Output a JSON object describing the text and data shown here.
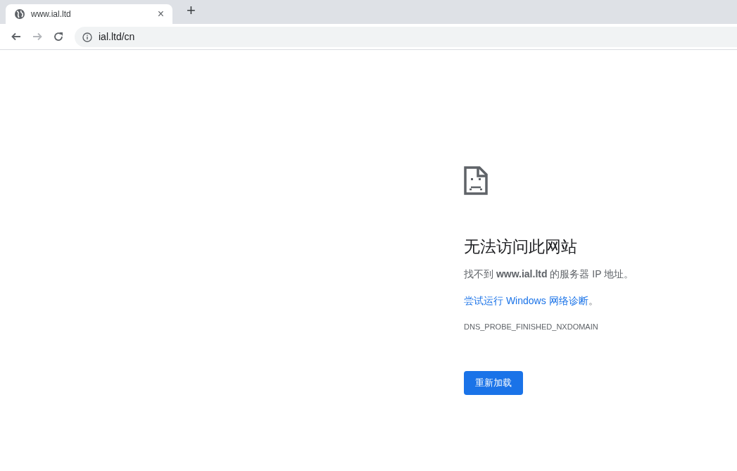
{
  "tabs": [
    {
      "title": "www.ial.ltd",
      "selected": true,
      "close": "×"
    }
  ],
  "new_tab": "+",
  "toolbar": {
    "back": {
      "disabled": false
    },
    "forward": {
      "disabled": true
    },
    "reload": {
      "disabled": false
    }
  },
  "address_bar": {
    "value": "ial.ltd/cn"
  },
  "error": {
    "title": "无法访问此网站",
    "message": "找不到 **www.ial.ltd** 的服务器 IP 地址。",
    "suggestion_link": "尝试运行 Windows 网络诊断",
    "suggestion_after": "。",
    "code": "DNS_PROBE_FINISHED_NXDOMAIN",
    "button": "重新加载"
  }
}
